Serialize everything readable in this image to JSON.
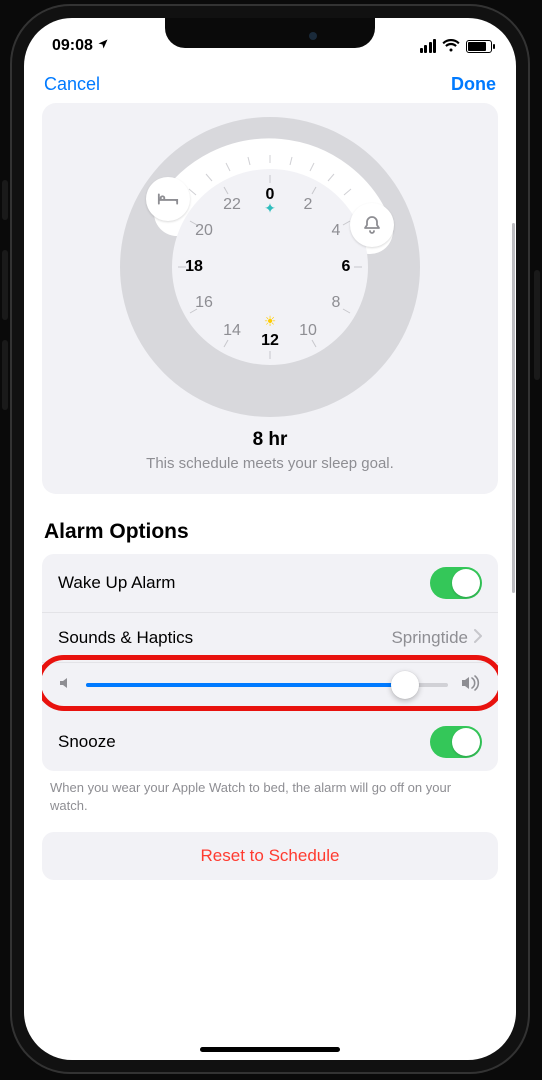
{
  "status": {
    "time": "09:08"
  },
  "nav": {
    "cancel": "Cancel",
    "done": "Done"
  },
  "dial": {
    "hours": [
      "0",
      "2",
      "4",
      "6",
      "8",
      "10",
      "12",
      "14",
      "16",
      "18",
      "20",
      "22"
    ],
    "duration": "8 hr",
    "goal_text": "This schedule meets your sleep goal."
  },
  "alarm": {
    "section_title": "Alarm Options",
    "wake_label": "Wake Up Alarm",
    "wake_on": true,
    "sounds_label": "Sounds & Haptics",
    "sounds_value": "Springtide",
    "volume_pct": 88,
    "snooze_label": "Snooze",
    "snooze_on": true,
    "note": "When you wear your Apple Watch to bed, the alarm will go off on your watch."
  },
  "reset": {
    "label": "Reset to Schedule"
  },
  "colors": {
    "accent": "#007aff",
    "green": "#34c759",
    "destructive": "#ff3b30",
    "highlight": "#e8120e"
  }
}
